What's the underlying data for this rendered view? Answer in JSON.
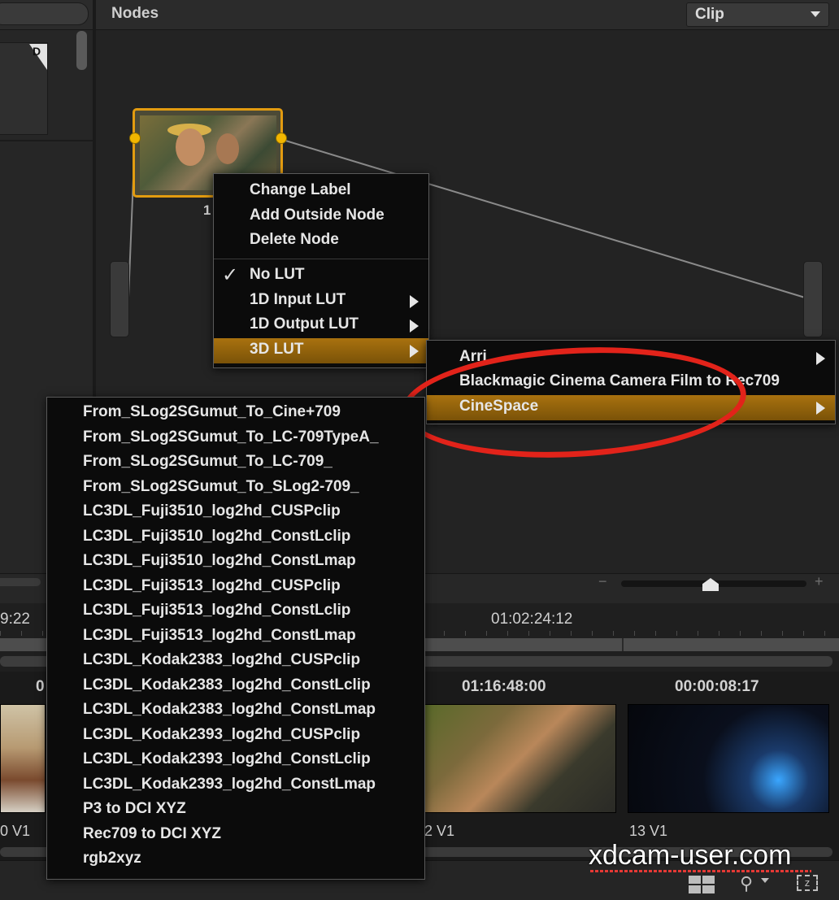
{
  "header": {
    "title": "Nodes",
    "view_select": "Clip"
  },
  "left_panel": {
    "badge": "D"
  },
  "node": {
    "number": "1"
  },
  "context_menu": {
    "items": [
      {
        "label": "Change Label"
      },
      {
        "label": "Add Outside Node"
      },
      {
        "label": "Delete Node"
      }
    ],
    "lut_items": [
      {
        "label": "No LUT",
        "checked": true
      },
      {
        "label": "1D Input LUT",
        "submenu": true
      },
      {
        "label": "1D Output LUT",
        "submenu": true
      },
      {
        "label": "3D LUT",
        "submenu": true,
        "highlighted": true
      }
    ]
  },
  "lut3d_submenu": {
    "items": [
      {
        "label": "Arri",
        "submenu": true
      },
      {
        "label": "Blackmagic Cinema Camera Film to Rec709"
      },
      {
        "label": "CineSpace",
        "submenu": true,
        "highlighted": true
      }
    ]
  },
  "cinespace_submenu": {
    "items": [
      "From_SLog2SGumut_To_Cine+709",
      "From_SLog2SGumut_To_LC-709TypeA_",
      "From_SLog2SGumut_To_LC-709_",
      "From_SLog2SGumut_To_SLog2-709_",
      "LC3DL_Fuji3510_log2hd_CUSPclip",
      "LC3DL_Fuji3510_log2hd_ConstLclip",
      "LC3DL_Fuji3510_log2hd_ConstLmap",
      "LC3DL_Fuji3513_log2hd_CUSPclip",
      "LC3DL_Fuji3513_log2hd_ConstLclip",
      "LC3DL_Fuji3513_log2hd_ConstLmap",
      "LC3DL_Kodak2383_log2hd_CUSPclip",
      "LC3DL_Kodak2383_log2hd_ConstLclip",
      "LC3DL_Kodak2383_log2hd_ConstLmap",
      "LC3DL_Kodak2393_log2hd_CUSPclip",
      "LC3DL_Kodak2393_log2hd_ConstLclip",
      "LC3DL_Kodak2393_log2hd_ConstLmap",
      "P3 to DCI XYZ",
      "Rec709 to DCI XYZ",
      "rgb2xyz"
    ]
  },
  "zoom": {
    "minus": "−",
    "plus": "+"
  },
  "timeline": {
    "tc_left": "9:22",
    "tc_mid": "01:02:24:12"
  },
  "clips": [
    {
      "timecode": "0",
      "track": "0 V1"
    },
    {
      "timecode": "01:16:48:00",
      "track": "2 V1"
    },
    {
      "timecode": "00:00:08:17",
      "track": "13 V1"
    }
  ],
  "watermark": "xdcam-user.com",
  "colors": {
    "accent": "#e29b10",
    "highlight": "#9a6a0d",
    "annotation": "#e2231a"
  },
  "icons": [
    "grid-view-icon",
    "search-icon",
    "fit-icon",
    "check-icon",
    "submenu-arrow-icon",
    "dropdown-arrow-icon"
  ]
}
